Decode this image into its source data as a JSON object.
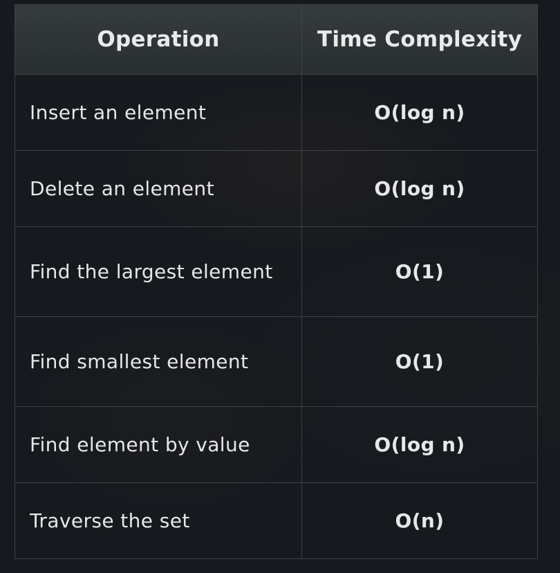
{
  "table": {
    "headers": [
      "Operation",
      "Time Complexity"
    ],
    "rows": [
      {
        "operation": "Insert an element",
        "complexity": "O(log n)"
      },
      {
        "operation": "Delete an element",
        "complexity": "O(log n)"
      },
      {
        "operation": "Find the largest element",
        "complexity": "O(1)"
      },
      {
        "operation": "Find smallest element",
        "complexity": "O(1)"
      },
      {
        "operation": "Find element by value",
        "complexity": "O(log n)"
      },
      {
        "operation": "Traverse the set",
        "complexity": "O(n)"
      }
    ]
  }
}
